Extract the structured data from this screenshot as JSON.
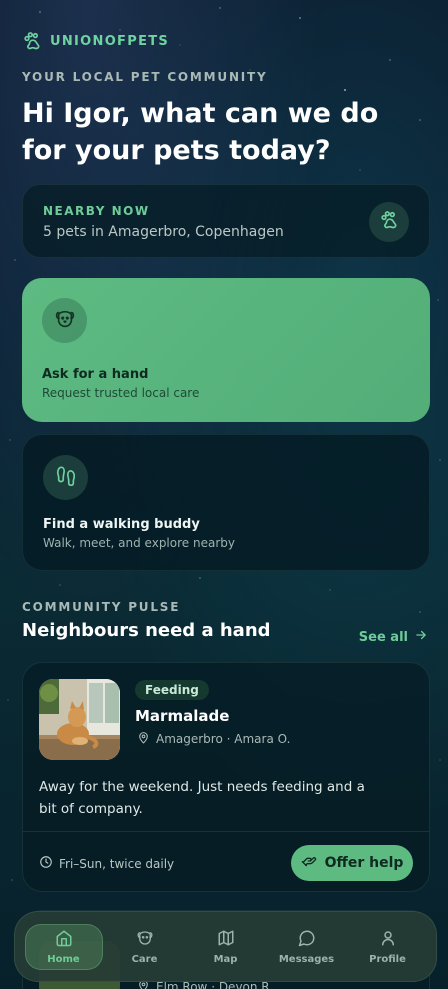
{
  "brand": {
    "name": "UNIONOFPETS",
    "icon": "paw-icon"
  },
  "hero": {
    "eyebrow": "YOUR LOCAL PET COMMUNITY",
    "headline": "Hi Igor, what can we do for your pets today?"
  },
  "nearby": {
    "label": "NEARBY NOW",
    "text": "5 pets in Amagerbro, Copenhagen",
    "icon": "paw-icon"
  },
  "actions": [
    {
      "title": "Ask for a hand",
      "subtitle": "Request trusted local care",
      "icon": "dog-face-icon"
    },
    {
      "title": "Find a walking buddy",
      "subtitle": "Walk, meet, and explore nearby",
      "icon": "footprints-icon"
    }
  ],
  "community": {
    "eyebrow": "COMMUNITY PULSE",
    "title": "Neighbours need a hand",
    "see_all": "See all"
  },
  "requests": [
    {
      "tag": "Feeding",
      "pet_name": "Marmalade",
      "location": "Amagerbro · Amara O.",
      "description": "Away for the weekend. Just needs feeding and a bit of company.",
      "schedule": "Fri–Sun, twice daily",
      "action": "Offer help"
    },
    {
      "location": "Elm Row · Devon R."
    }
  ],
  "tabs": [
    {
      "label": "Home",
      "icon": "home-icon",
      "active": true
    },
    {
      "label": "Care",
      "icon": "dog-face-icon",
      "active": false
    },
    {
      "label": "Map",
      "icon": "map-icon",
      "active": false
    },
    {
      "label": "Messages",
      "icon": "chat-bubble-icon",
      "active": false
    },
    {
      "label": "Profile",
      "icon": "user-icon",
      "active": false
    }
  ],
  "colors": {
    "accent": "#5dbb82",
    "accent_text": "#6fcc98",
    "background": "#0a2233",
    "card": "#061c24"
  }
}
